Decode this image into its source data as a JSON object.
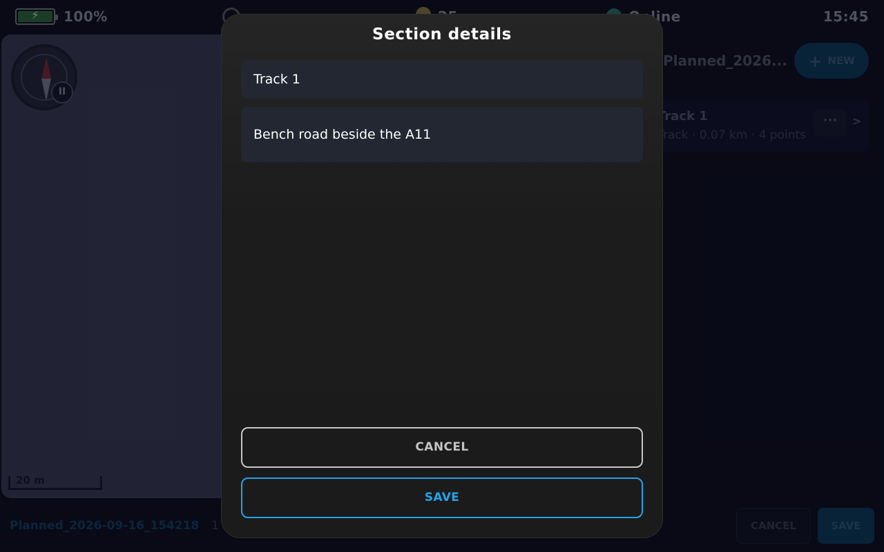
{
  "status_bar": {
    "battery_percent": "100%",
    "battery_level": 1.0,
    "temperature": "25",
    "network": "Online",
    "time": "15:45",
    "icons": [
      "battery-charging-icon",
      "gps-icon",
      "sun-icon",
      "globe-icon"
    ]
  },
  "map": {
    "scale_label": "20 m",
    "pause_symbol": "II",
    "icons": [
      "compass-icon",
      "pause-icon"
    ]
  },
  "right_panel": {
    "project_title": "Planned_2026...",
    "new_button_label": "NEW",
    "track": {
      "name": "Track 1",
      "meta": "Track · 0.07 km · 4 points",
      "menu_symbol": "···",
      "chevron_symbol": ">"
    }
  },
  "bottom_bar": {
    "project_name": "Planned_2026-09-16_154218",
    "count_text": "1 s",
    "cancel_label": "CANCEL",
    "save_label": "SAVE"
  },
  "modal": {
    "title": "Section details",
    "title_value": "Track 1",
    "description_value": "Bench road beside the A11",
    "cancel_label": "CANCEL",
    "save_label": "SAVE"
  },
  "colors": {
    "background": "#0d0e1d",
    "accent": "#1fa4ea",
    "modal_bg": "#1c1c1c",
    "field_bg": "#222731",
    "map_bg": "#3a3b52"
  }
}
